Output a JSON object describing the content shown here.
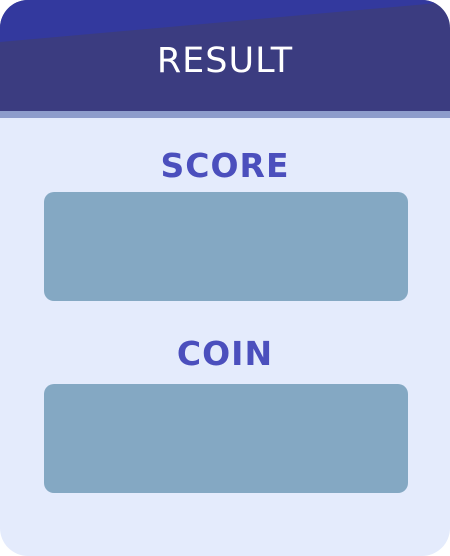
{
  "dialog": {
    "title": "RESULT",
    "score": {
      "label": "SCORE",
      "value": ""
    },
    "coin": {
      "label": "COIN",
      "value": ""
    }
  },
  "colors": {
    "panel_background": "#e4ebfc",
    "header_background": "#3b3c80",
    "header_sheen": "#33399e",
    "header_rule": "#8d9ccb",
    "label_text": "#4b4fbd",
    "value_box": "#84a8c3"
  }
}
